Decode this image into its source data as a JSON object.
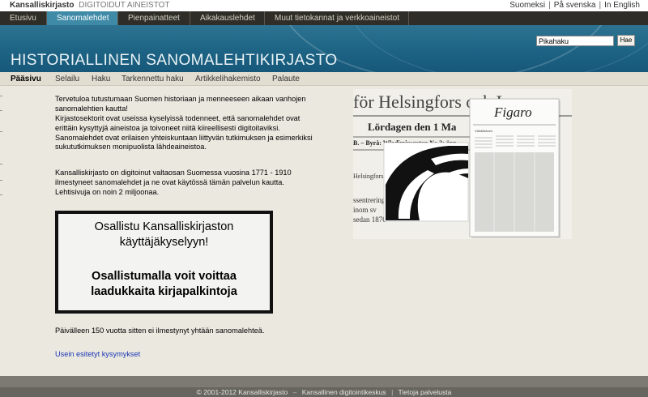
{
  "header": {
    "brand_name": "Kansalliskirjasto",
    "brand_sub": "DIGITOIDUT AINEISTOT",
    "languages": [
      "Suomeksi",
      "På svenska",
      "In English"
    ],
    "language_separator": "|"
  },
  "main_nav": {
    "tabs": [
      {
        "label": "Etusivu"
      },
      {
        "label": "Sanomalehdet",
        "active": true
      },
      {
        "label": "Pienpainatteet"
      },
      {
        "label": "Aikakauslehdet"
      },
      {
        "label": "Muut tietokannat ja verkkoaineistot"
      }
    ]
  },
  "banner": {
    "title": "HISTORIALLINEN SANOMALEHTIKIRJASTO",
    "search_placeholder": "Pikahaku",
    "search_button": "Hae"
  },
  "sub_nav": {
    "tabs": [
      {
        "label": "Pääsivu",
        "active": true
      },
      {
        "label": "Selailu"
      },
      {
        "label": "Haku"
      },
      {
        "label": "Tarkennettu haku"
      },
      {
        "label": "Artikkelihakemisto"
      },
      {
        "label": "Palaute"
      }
    ]
  },
  "content": {
    "intro": "Tervetuloa tutustumaan Suomen historiaan ja menneeseen aikaan vanhojen sanomalehtien kautta!",
    "paragraph_2": "Kirjastosektorit ovat useissa kyselyissä todenneet, että sanomalehdet ovat erittäin kysyttyjä aineistoa ja toivoneet niitä kiireellisesti digitoitaviksi. Sanomalehdet ovat erilaisen yhteiskuntaan liittyvän tutkimuksen ja esimerkiksi sukututkimuksen monipuolista lähdeaineistoa.",
    "paragraph_3": "Kansalliskirjasto on digitoinut valtaosan Suomessa vuosina 1771 - 1910 ilmestyneet sanomalehdet ja ne ovat käytössä tämän palvelun kautta. Lehtisivuja on noin 2 miljoonaa.",
    "promo_line1": "Osallistu Kansalliskirjaston käyttäjäkyselyyn!",
    "promo_line2": "Osallistumalla voit voittaa laadukkaita kirjapalkintoja",
    "today_note": "Päivälleen 150 vuotta sitten ei ilmestynyt yhtään sanomalehteä.",
    "faq_link": "Usein esitetyt kysymykset"
  },
  "illustration": {
    "masthead": "för Helsingfors och L",
    "date_line": "Lördagen den 1 Ma",
    "byline": "B. – Byrå: Wladimirsgatan No 3; öpp",
    "side_text": "Helsingfors",
    "body_lines": [
      "ssentrering",
      "inom sv",
      "sedan 1870"
    ],
    "mini_masthead": "Figaro",
    "mini_subline": "Vähälläänen"
  },
  "footer": {
    "copyright": "© 2001-2012",
    "links": [
      "Kansalliskirjasto",
      "Kansallinen digitointikeskus",
      "Tietoja palvelusta"
    ],
    "separators": [
      "–",
      "|"
    ]
  }
}
